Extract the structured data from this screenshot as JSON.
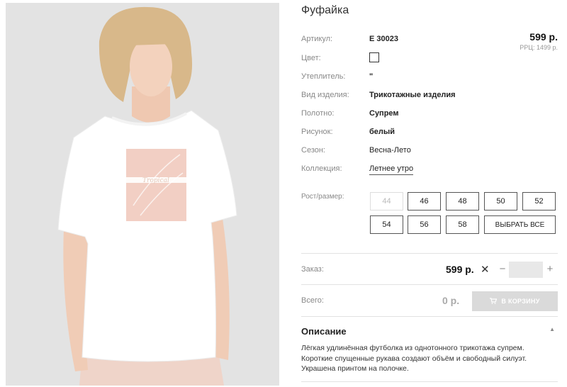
{
  "product": {
    "title": "Фуфайка",
    "price": "599 р.",
    "rrc": "РРЦ: 1499 р."
  },
  "specs": [
    {
      "label": "Артикул:",
      "value": "E 30023",
      "bold": true
    },
    {
      "label": "Цвет:",
      "value": "",
      "swatch": "#ffffff"
    },
    {
      "label": "Утеплитель:",
      "value": "\"",
      "bold": true
    },
    {
      "label": "Вид изделия:",
      "value": "Трикотажные изделия",
      "bold": true
    },
    {
      "label": "Полотно:",
      "value": "Супрем",
      "bold": true
    },
    {
      "label": "Рисунок:",
      "value": "белый",
      "bold": true
    },
    {
      "label": "Сезон:",
      "value": "Весна-Лето",
      "bold": false
    },
    {
      "label": "Коллекция:",
      "value": "Летнее утро",
      "link": true
    }
  ],
  "sizes": {
    "label": "Рост/размер:",
    "items": [
      {
        "label": "44",
        "disabled": true
      },
      {
        "label": "46",
        "disabled": false
      },
      {
        "label": "48",
        "disabled": false
      },
      {
        "label": "50",
        "disabled": false
      },
      {
        "label": "52",
        "disabled": false
      },
      {
        "label": "54",
        "disabled": false
      },
      {
        "label": "56",
        "disabled": false
      },
      {
        "label": "58",
        "disabled": false
      }
    ],
    "select_all": "ВЫБРАТЬ ВСЕ"
  },
  "order": {
    "label": "Заказ:",
    "price": "599 р.",
    "times": "✕",
    "minus": "−",
    "plus": "+",
    "quantity": ""
  },
  "total": {
    "label": "Всего:",
    "value": "0 р.",
    "cart_button": "В КОРЗИНУ"
  },
  "description": {
    "title": "Описание",
    "toggle": "▲",
    "lines": [
      "Лёгкая удлинённая футболка из однотонного трикотажа супрем.",
      "Короткие спущенные рукава создают объём и свободный силуэт.",
      "Украшена принтом на полочке."
    ]
  },
  "photo": {
    "print_text": "Tropical",
    "background": "#e3e3e3",
    "print_color": "#f2cfc4"
  },
  "colors": {
    "border": "#555555",
    "disabled": "#bbbbbb",
    "cart_bg": "#dadada"
  }
}
